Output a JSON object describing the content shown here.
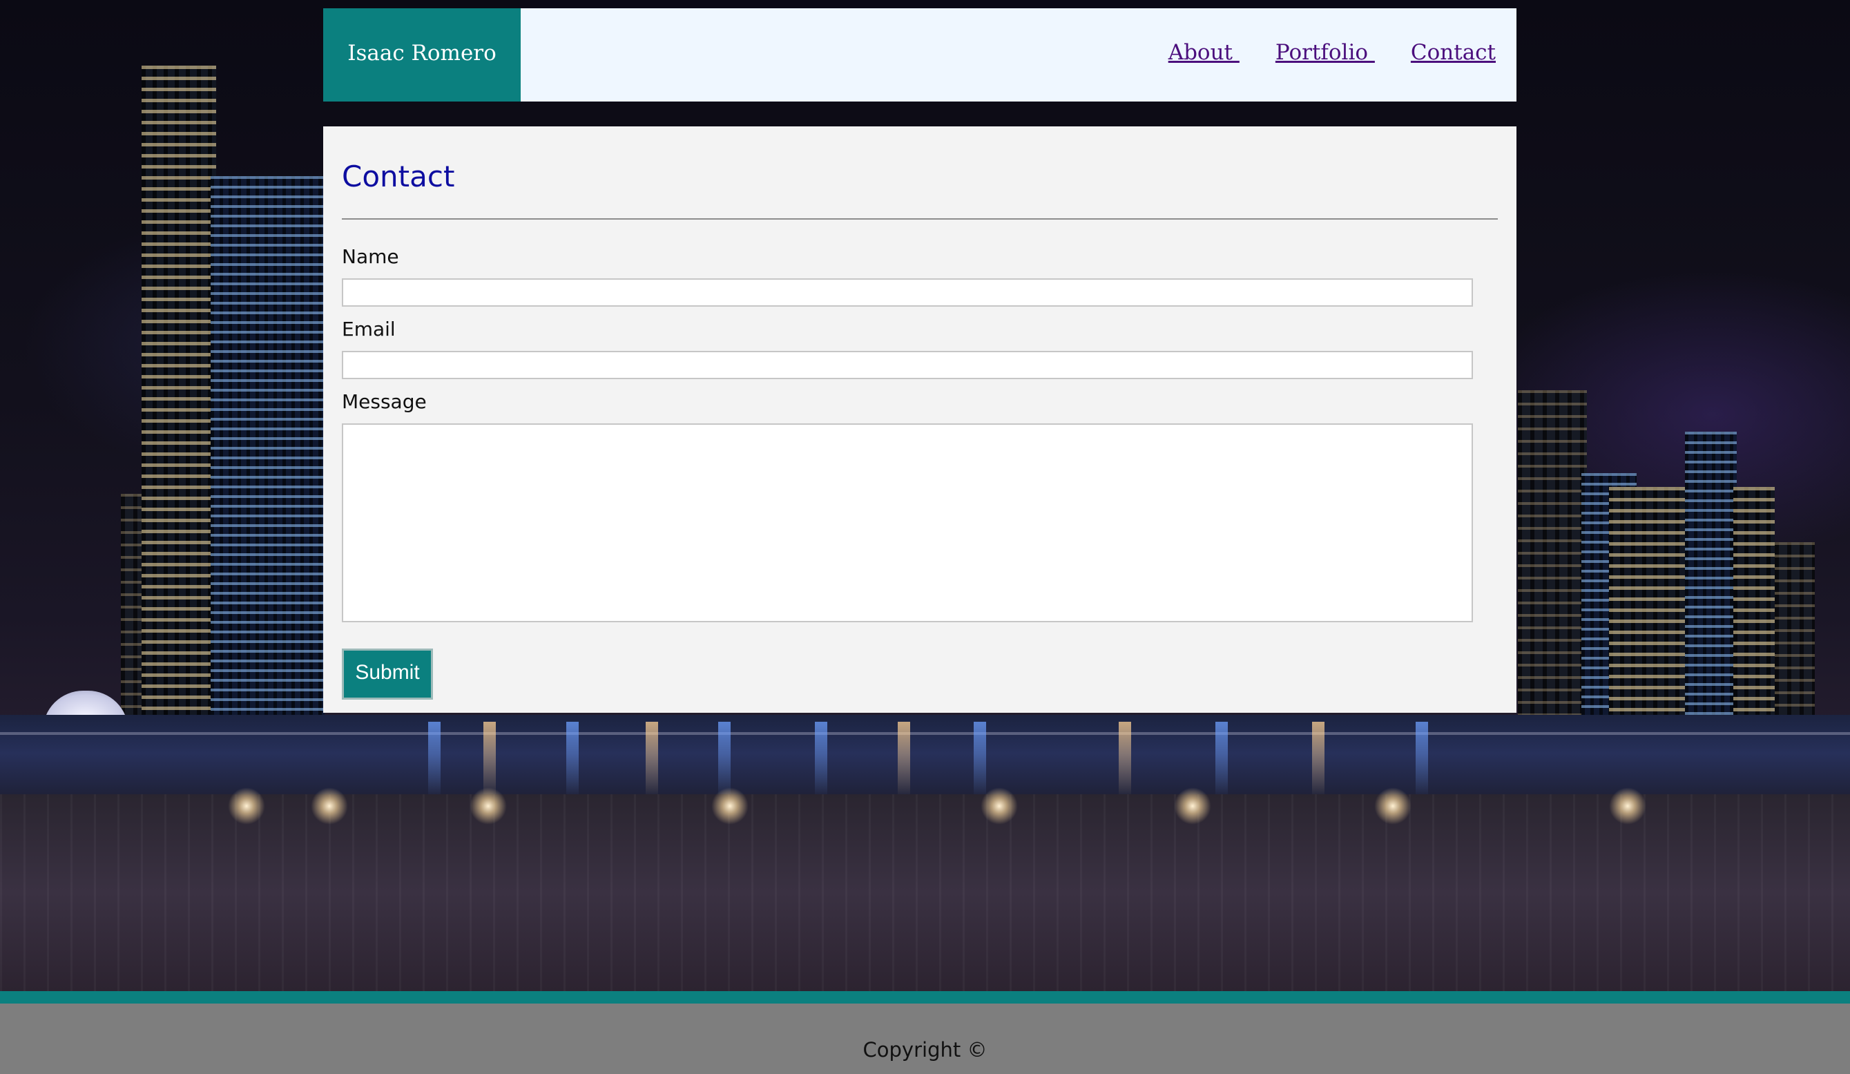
{
  "header": {
    "brand": "Isaac Romero",
    "nav": [
      {
        "label": "About "
      },
      {
        "label": "Portfolio "
      },
      {
        "label": "Contact"
      }
    ]
  },
  "contact": {
    "title": "Contact",
    "name_label": "Name",
    "name_value": "",
    "email_label": "Email",
    "email_value": "",
    "message_label": "Message",
    "message_value": "",
    "submit_label": "Submit"
  },
  "footer": {
    "copyright": "Copyright ©"
  },
  "colors": {
    "accent": "#0b807f",
    "title": "#0d0da0",
    "nav_link": "#4b0f7d",
    "header_bg": "#eff7ff",
    "card_bg": "#f3f3f3",
    "footer_bg": "#7e7e7e"
  }
}
